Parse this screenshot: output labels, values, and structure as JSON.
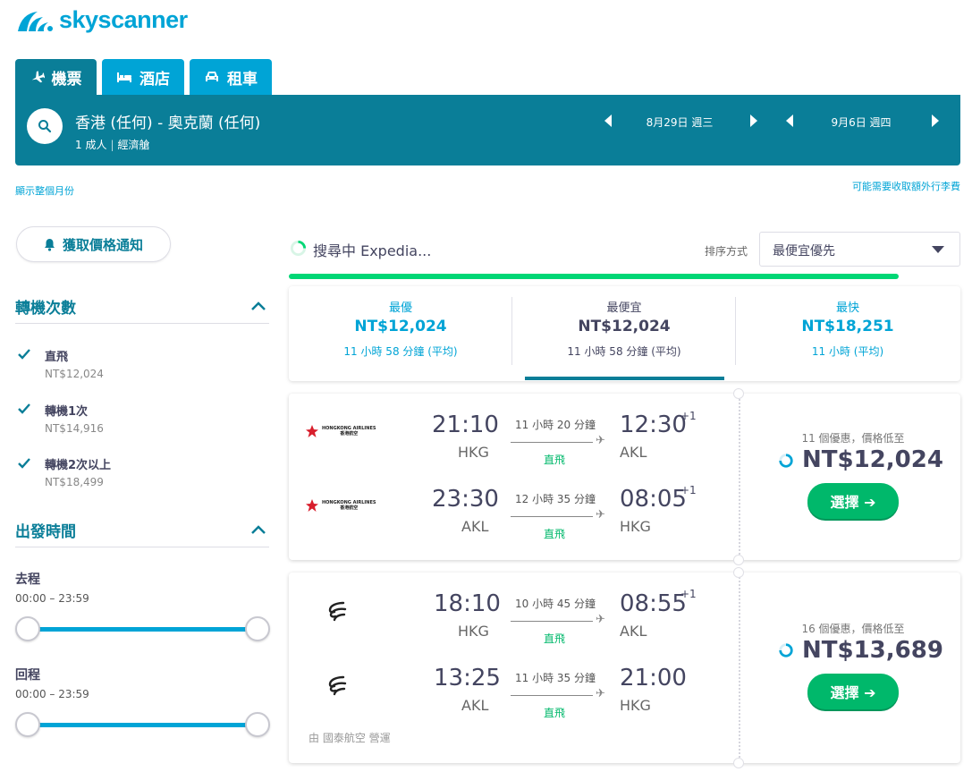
{
  "brand": {
    "name": "skyscanner",
    "color": "#00a4d6"
  },
  "tabs": [
    {
      "label": "機票",
      "icon": "plane-icon"
    },
    {
      "label": "酒店",
      "icon": "bed-icon"
    },
    {
      "label": "租車",
      "icon": "car-icon"
    }
  ],
  "search": {
    "route": "香港 (任何) - 奧克蘭 (任何)",
    "passengers": "1 成人",
    "cabin": "經濟艙",
    "depart_date": "8月29日 週三",
    "return_date": "9月6日 週四"
  },
  "links": {
    "show_month": "顯示整個月份",
    "baggage_fees": "可能需要收取額外行李費"
  },
  "price_alert": {
    "label": "獲取價格通知"
  },
  "filters": {
    "stops": {
      "title": "轉機次數",
      "options": [
        {
          "label": "直飛",
          "price": "NT$12,024",
          "checked": true
        },
        {
          "label": "轉機1次",
          "price": "NT$14,916",
          "checked": true
        },
        {
          "label": "轉機2次以上",
          "price": "NT$18,499",
          "checked": true
        }
      ]
    },
    "times": {
      "title": "出發時間",
      "outbound": {
        "label": "去程",
        "range": "00:00 – 23:59",
        "min": 0,
        "max": 1
      },
      "return": {
        "label": "回程",
        "range": "00:00 – 23:59",
        "min": 0,
        "max": 1
      }
    }
  },
  "status": {
    "text": "搜尋中 Expedia...",
    "progress": 0.91
  },
  "sort": {
    "label": "排序方式",
    "value": "最便宜優先"
  },
  "summary": [
    {
      "title": "最優",
      "price": "NT$12,024",
      "duration": "11 小時 58 分鐘 (平均)",
      "active": false
    },
    {
      "title": "最便宜",
      "price": "NT$12,024",
      "duration": "11 小時 58 分鐘 (平均)",
      "active": true
    },
    {
      "title": "最快",
      "price": "NT$18,251",
      "duration": "11 小時 (平均)",
      "active": false
    }
  ],
  "results": [
    {
      "airline": "Hong Kong Airlines",
      "airline_logo_text": [
        "HONGKONG AIRLINES",
        "香港航空"
      ],
      "legs": [
        {
          "dep_time": "21:10",
          "dep_code": "HKG",
          "duration": "11 小時 20 分鐘",
          "stops": "直飛",
          "arr_time": "12:30",
          "arr_code": "AKL",
          "day_offset": "+1"
        },
        {
          "dep_time": "23:30",
          "dep_code": "AKL",
          "duration": "12 小時 35 分鐘",
          "stops": "直飛",
          "arr_time": "08:05",
          "arr_code": "HKG",
          "day_offset": "+1"
        }
      ],
      "deals": "11 個優惠，價格低至",
      "price": "NT$12,024",
      "select_label": "選擇 ➔",
      "operated_by": ""
    },
    {
      "airline": "Air New Zealand",
      "legs": [
        {
          "dep_time": "18:10",
          "dep_code": "HKG",
          "duration": "10 小時 45 分鐘",
          "stops": "直飛",
          "arr_time": "08:55",
          "arr_code": "AKL",
          "day_offset": "+1"
        },
        {
          "dep_time": "13:25",
          "dep_code": "AKL",
          "duration": "11 小時 35 分鐘",
          "stops": "直飛",
          "arr_time": "21:00",
          "arr_code": "HKG",
          "day_offset": ""
        }
      ],
      "deals": "16 個優惠，價格低至",
      "price": "NT$13,689",
      "select_label": "選擇 ➔",
      "operated_by": "由 國泰航空 營運"
    }
  ]
}
